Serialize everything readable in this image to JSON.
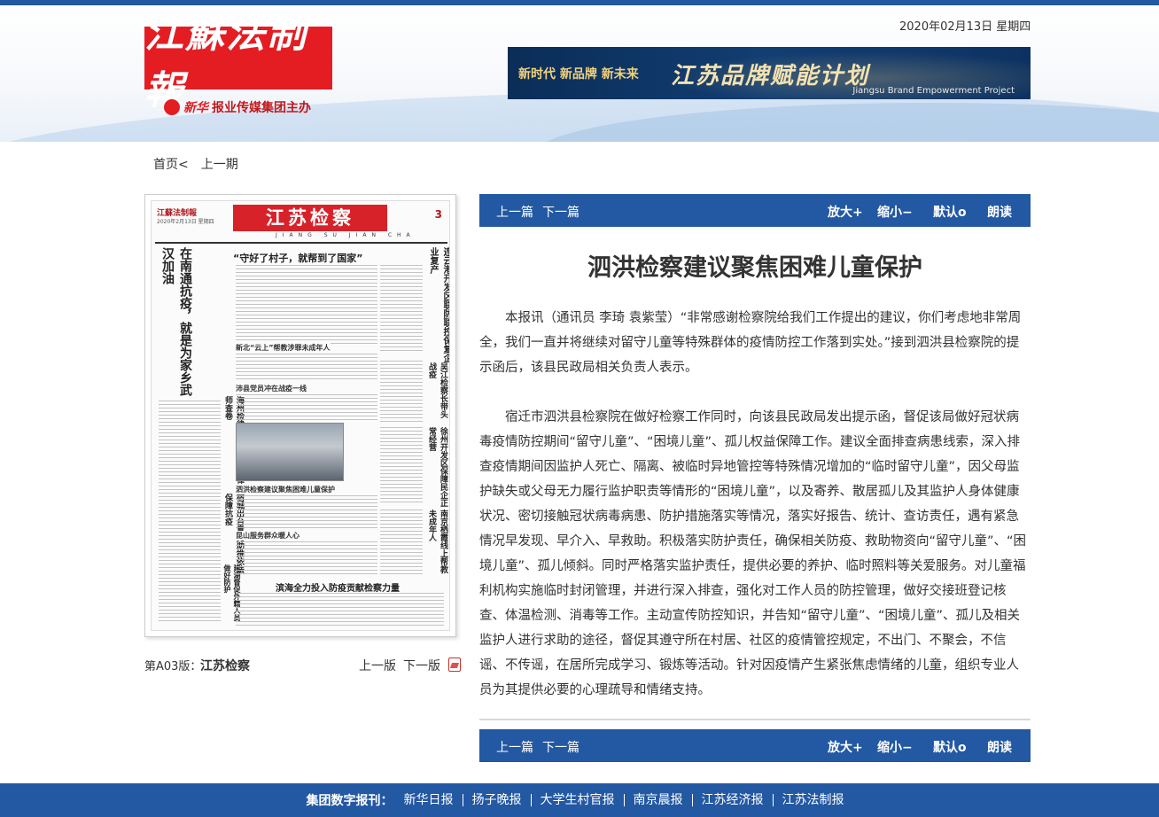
{
  "header": {
    "logo_text": "江蘇法制報",
    "sponsor_brand": "新华",
    "sponsor_text": "报业传媒集团主办",
    "date": "2020年02月13日  星期四",
    "banner": {
      "slogan": "新时代  新品牌  新未来",
      "title": "江苏品牌赋能计划",
      "subtitle": "Jiangsu Brand Empowerment Project"
    }
  },
  "breadcrumb": {
    "home": "首页<",
    "prev_issue": "上一期"
  },
  "paper_thumbnail": {
    "mini_logo": "江蘇法制報",
    "mini_date": "2020年2月13日 星期四",
    "section": "江苏检察",
    "section_pinyin": "JIANG SU JIAN CHA",
    "page_no": "3",
    "headline": "“守好了村子，就帮到了国家”",
    "vertical_head_1": "在南通抗疫，就是为家乡武汉加油",
    "vertical_head_2": "连云港开发区联防联控保复企业复产",
    "vertical_head_3": "海州检律互动平台服务律师查卷",
    "vertical_head_4": "吴江检察长带头战疫",
    "vertical_head_5": "徐州开发区保障民企正常经营",
    "vertical_head_6": "南京栖霞线上帮教未成年人",
    "vertical_head_7": "宿城出台意见助推依法保障抗疫",
    "vertical_head_8": "建湖督促外籍人员做好防护",
    "subhead_1": "新北“云上”帮教涉罪未成年人",
    "subhead_2": "沛县党员冲在战疫一线",
    "subhead_3": "泗洪检察建议聚焦困难儿童保护",
    "subhead_4": "昆山服务群众暖人心",
    "bottom_head": "滨海全力投入防疫贡献检察力量"
  },
  "page_info": {
    "label": "第A03版：",
    "name": "江苏检察",
    "prev_page": "上一版",
    "next_page": "下一版",
    "pdf_icon": "pdf-icon"
  },
  "toolbar": {
    "prev_article": "上一篇",
    "next_article": "下一篇",
    "zoom_in": "放大+",
    "zoom_out": "缩小−",
    "default": "默认o",
    "read_aloud": "朗读"
  },
  "article": {
    "title": "泗洪检察建议聚焦困难儿童保护",
    "paragraphs": [
      "本报讯（通讯员 李琦 袁紫莹）“非常感谢检察院给我们工作提出的建议，你们考虑地非常周全，我们一直并将继续对留守儿童等特殊群体的疫情防控工作落到实处。”接到泗洪县检察院的提示函后，该县民政局相关负责人表示。",
      "宿迁市泗洪县检察院在做好检察工作同时，向该县民政局发出提示函，督促该局做好冠状病毒疫情防控期间“留守儿童”、“困境儿童”、孤儿权益保障工作。建议全面排查病患线索，深入排查疫情期间因监护人死亡、隔离、被临时异地管控等特殊情况增加的“临时留守儿童”，因父母监护缺失或父母无力履行监护职责等情形的“困境儿童”，以及寄养、散居孤儿及其监护人身体健康状况、密切接触冠状病毒病患、防护措施落实等情况，落实好报告、统计、查访责任，遇有紧急情况早发现、早介入、早救助。积极落实防护责任，确保相关防疫、救助物资向“留守儿童”、“困境儿童”、孤儿倾斜。同时严格落实监护责任，提供必要的养护、临时照料等关爱服务。对儿童福利机构实施临时封闭管理，并进行深入排查，强化对工作人员的防控管理，做好交接班登记核查、体温检测、消毒等工作。主动宣传防控知识，并告知“留守儿童”、“困境儿童”、孤儿及相关监护人进行求助的途径，督促其遵守所在村居、社区的疫情管控规定，不出门、不聚会，不信谣、不传谣，在居所完成学习、锻炼等活动。针对因疫情产生紧张焦虑情绪的儿童，组织专业人员为其提供必要的心理疏导和情绪支持。"
    ]
  },
  "footer": {
    "label": "集团数字报刊：",
    "links": [
      "新华日报",
      "扬子晚报",
      "大学生村官报",
      "南京晨报",
      "江苏经济报",
      "江苏法制报"
    ]
  }
}
